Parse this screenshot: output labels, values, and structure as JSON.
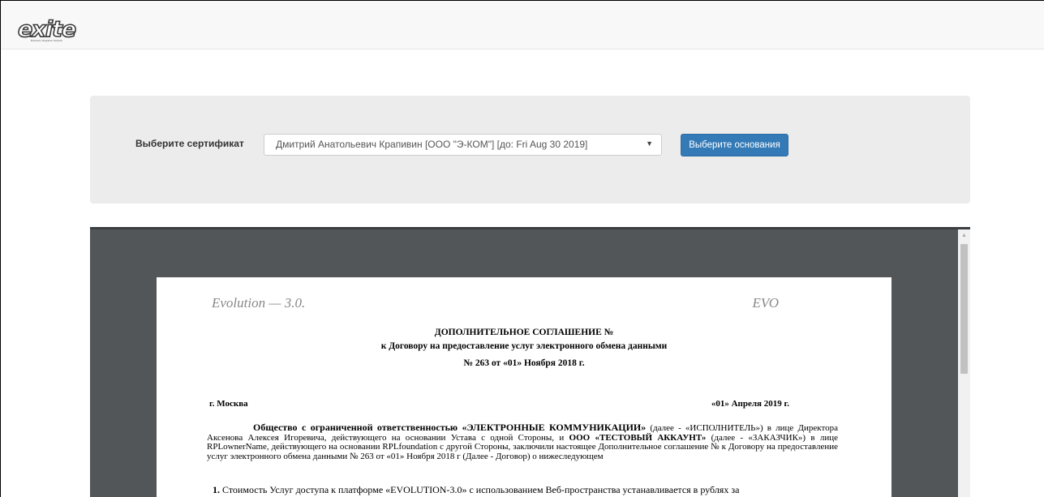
{
  "header": {
    "logo_text": "exite",
    "logo_subtitle": "Business Integration Network"
  },
  "certificate": {
    "label": "Выберите сертификат",
    "selected_value": "Дмитрий Анатольевич Крапивин [ООО \"Э-КОМ\"] [до: Fri Aug 30 2019]",
    "button_label": "Выберите основания"
  },
  "document": {
    "header_left": "Evolution — 3.0.",
    "header_right": "EVO",
    "title_line1": "ДОПОЛНИТЕЛЬНОЕ СОГЛАШЕНИЕ №",
    "title_line2": "к Договору на предоставление услуг электронного обмена данными",
    "title_line3": "№ 263  от «01»  Ноября  2018 г.",
    "city": "г. Москва",
    "date": "«01» Апреля 2019 г.",
    "para_lead_bold": "Общество с ограниченной ответственностью «ЭЛЕКТРОННЫЕ КОММУНИКАЦИИ»",
    "para_text1": " (далее - «ИСПОЛНИТЕЛЬ») в лице Директора Аксенова Алексея Игоревича, действующего на основании Устава с одной Стороны, и ",
    "para_bold2": "ООО «ТЕСТОВЫЙ АККАУНТ»",
    "para_text2": " (далее - «ЗАКАЗЧИК») в лице RPLownerName, действующего на основании RPLfoundation с другой Стороны, заключили настоящее Дополнительное соглашение №          к Договору на предоставление услуг электронного обмена данными № 263  от «01» Ноября 2018 г  (Далее - Договор) о нижеследующем",
    "item1_number": "1.",
    "item1_text": " Стоимость Услуг доступа к платформе «EVOLUTION-3.0» с использованием Веб-пространства устанавливается в рублях за"
  }
}
